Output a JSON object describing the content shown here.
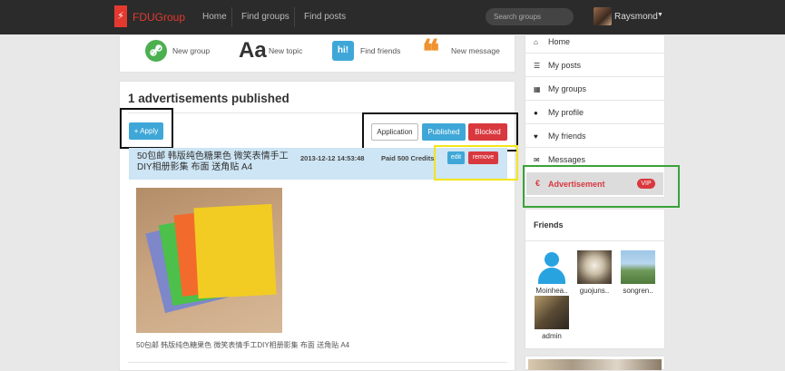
{
  "header": {
    "brand": "FDUGroup",
    "nav": [
      "Home",
      "Find groups",
      "Find posts"
    ],
    "search_placeholder": "Search groups",
    "user": "Raysmond"
  },
  "quick_actions": [
    {
      "label": "New group",
      "icon": "link-icon"
    },
    {
      "label": "New topic",
      "icon": "text-icon",
      "glyph": "Aa"
    },
    {
      "label": "Find friends",
      "icon": "hi-bubble-icon",
      "glyph": "hi!"
    },
    {
      "label": "New message",
      "icon": "quote-icon",
      "glyph": "❝"
    }
  ],
  "main": {
    "title": "1 advertisements published",
    "apply_label": "+ Apply",
    "filters": [
      "Application",
      "Published",
      "Blocked"
    ],
    "ad": {
      "title": "50包邮 韩版纯色糖果色 微笑表情手工DIY相册影集 布面 送角贴 A4",
      "date": "2013-12-12 14:53:48",
      "paid": "Paid 500 Credits",
      "edit_label": "edit",
      "remove_label": "remove",
      "caption": "50包邮 韩版纯色糖果色 微笑表情手工DIY相册影集 布面 送角贴 A4"
    }
  },
  "sidebar": {
    "menu": [
      {
        "label": "Home",
        "icon": "home-icon",
        "glyph": "⌂"
      },
      {
        "label": "My posts",
        "icon": "list-icon",
        "glyph": "☰"
      },
      {
        "label": "My groups",
        "icon": "grid-icon",
        "glyph": "▦"
      },
      {
        "label": "My profile",
        "icon": "user-icon",
        "glyph": "●"
      },
      {
        "label": "My friends",
        "icon": "heart-icon",
        "glyph": "♥"
      },
      {
        "label": "Messages",
        "icon": "envelope-icon",
        "glyph": "✉"
      }
    ],
    "advertisement": {
      "label": "Advertisement",
      "glyph": "€",
      "badge": "VIP"
    },
    "friends_title": "Friends",
    "friends": [
      "Moinhea..",
      "guojuns..",
      "songren..",
      "admin"
    ]
  },
  "colors": {
    "accent_blue": "#3fa7d7",
    "accent_red": "#d9383f",
    "brand_red": "#e4392f"
  }
}
